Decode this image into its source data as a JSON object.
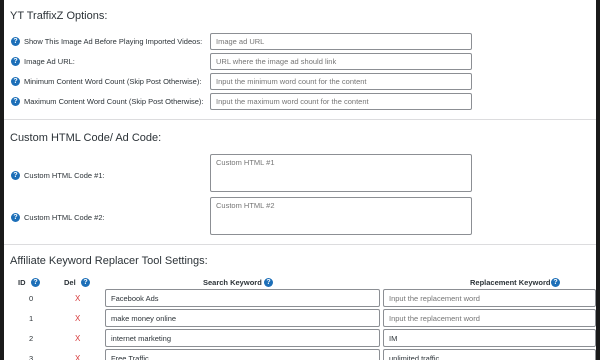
{
  "yt_options": {
    "title": "YT TraffixZ Options:",
    "fields": [
      {
        "label": "Show This Image Ad Before Playing Imported Videos:",
        "value": "",
        "placeholder": "Image ad URL"
      },
      {
        "label": "Image Ad URL:",
        "value": "",
        "placeholder": "URL where the image ad should link"
      },
      {
        "label": "Minimum Content Word Count (Skip Post Otherwise):",
        "value": "",
        "placeholder": "Input the minimum word count for the content"
      },
      {
        "label": "Maximum Content Word Count (Skip Post Otherwise):",
        "value": "",
        "placeholder": "Input the maximum word count for the content"
      }
    ]
  },
  "custom_html": {
    "title": "Custom HTML Code/ Ad Code:",
    "fields": [
      {
        "label": "Custom HTML Code #1:",
        "placeholder": "Custom HTML #1"
      },
      {
        "label": "Custom HTML Code #2:",
        "placeholder": "Custom HTML #2"
      }
    ]
  },
  "affiliate": {
    "title": "Affiliate Keyword Replacer Tool Settings:",
    "headers": {
      "id": "ID",
      "del": "Del",
      "search": "Search Keyword",
      "replacement": "Replacement Keyword"
    },
    "delete_glyph": "X",
    "rows": [
      {
        "id": "0",
        "search": "Facebook Ads",
        "replacement": "",
        "replacement_placeholder": "Input the replacement word"
      },
      {
        "id": "1",
        "search": "make money online",
        "replacement": "",
        "replacement_placeholder": "Input the replacement word"
      },
      {
        "id": "2",
        "search": "internet marketing",
        "replacement": "IM",
        "replacement_placeholder": ""
      },
      {
        "id": "3",
        "search": "Free Traffic",
        "replacement": "unlimited traffic",
        "replacement_placeholder": ""
      }
    ]
  },
  "help_glyph": "?",
  "colors": {
    "help_icon": "#1d6fb8",
    "delete": "#d63638",
    "border": "#8c8f94"
  }
}
